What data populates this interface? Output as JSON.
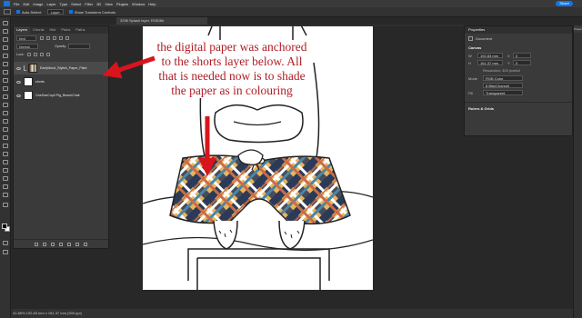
{
  "menubar": {
    "items": [
      "File",
      "Edit",
      "Image",
      "Layer",
      "Type",
      "Select",
      "Filter",
      "3D",
      "View",
      "Plugins",
      "Window",
      "Help"
    ],
    "share_label": "Share"
  },
  "options": {
    "auto_select_label": "Auto-Select:",
    "layer_select": "Layer",
    "transform_label": "Show Transform Controls"
  },
  "document": {
    "tab_title": "3256 Splash layer, RGB/8#"
  },
  "layers_panel": {
    "tabs": [
      "Layers",
      "Chnnls",
      "Hist",
      "Pstns",
      "Paths"
    ],
    "filter_label": "Kind",
    "blend_mode": "Normal",
    "opacity_label": "Opacity:",
    "lock_label": "Lock:",
    "layers": [
      {
        "name": "EarlyMood_Stylish_Paper_Plaid",
        "selected": true
      },
      {
        "name": "shorts",
        "selected": false
      },
      {
        "name": "OneDaeCopit Pig_BeachChair",
        "selected": false
      }
    ]
  },
  "callout": {
    "text": "the digital paper was anchored to the shorts layer below. All that is needed now is to shade the paper as in colouring",
    "color": "#b01c24"
  },
  "properties": {
    "title": "Properties",
    "subtitle": "Document",
    "canvas_label": "Canvas",
    "w_label": "W",
    "w_value": "192.83 mm",
    "h_label": "H",
    "h_value": "161.37 mm",
    "x_label": "X",
    "x_value": "0",
    "y_label": "Y",
    "y_value": "0",
    "resolution": "Resolution: 300 pixels/i",
    "mode_label": "Mode",
    "mode_value": "RGB Color",
    "depth_value": "8 Bits/Channel",
    "fill_label": "Fill",
    "fill_value": "Transparent",
    "rulers_label": "Rulers & Grids"
  },
  "collapsed_panel_label": "Properti...",
  "status": {
    "text": "41.86%    192.83 mm x 161.37 mm (300 ppi)"
  },
  "colors": {
    "accent": "#1473e6",
    "arrow": "#d8141c"
  }
}
